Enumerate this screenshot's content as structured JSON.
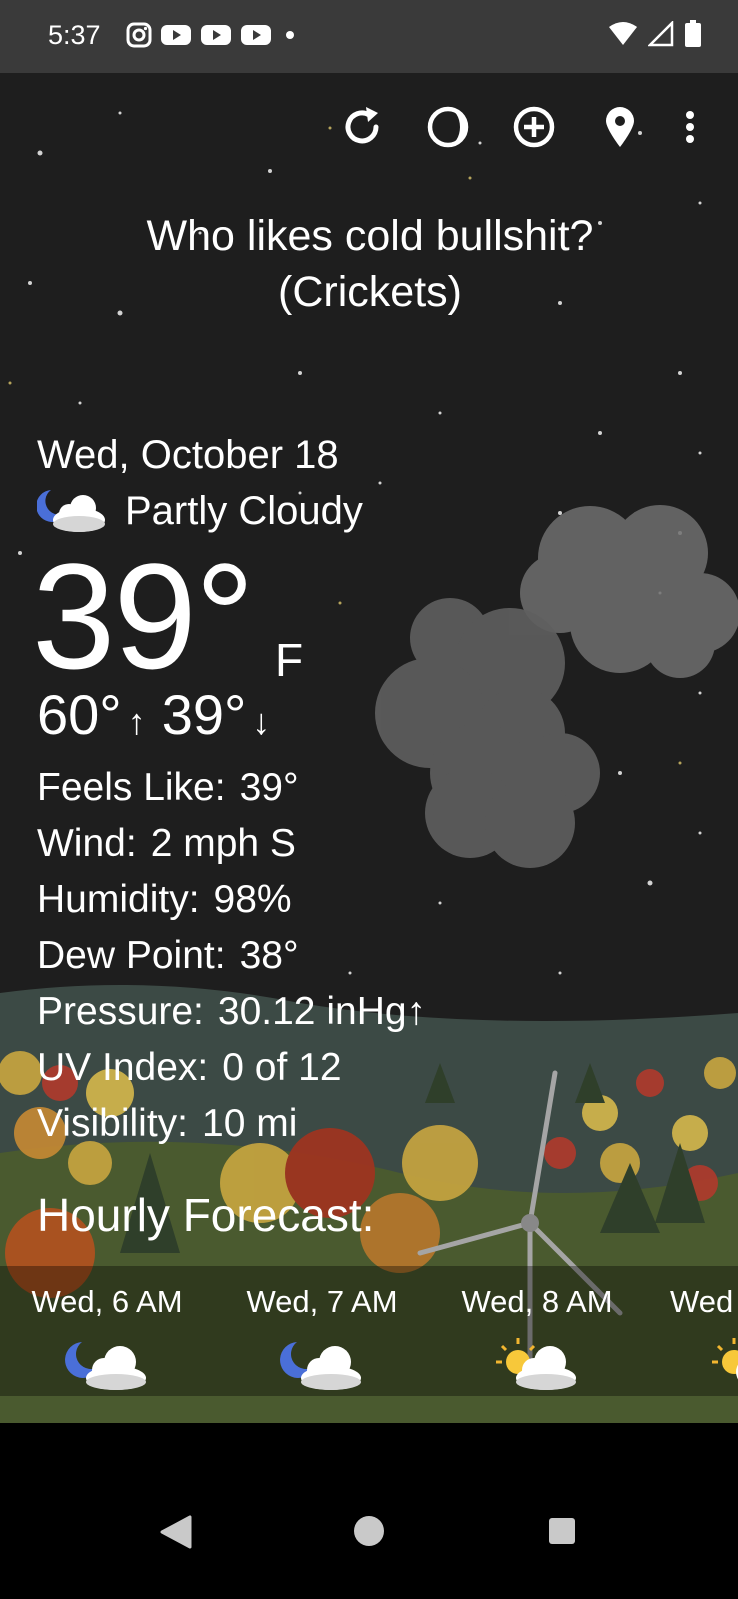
{
  "status_bar": {
    "time": "5:37",
    "notification_icons": [
      "instagram-icon",
      "youtube-icon",
      "youtube-icon",
      "youtube-icon",
      "dot-icon"
    ],
    "system_icons": [
      "wifi-icon",
      "cellular-signal-icon",
      "battery-icon"
    ]
  },
  "toolbar": {
    "icons": [
      "refresh-icon",
      "moon-phase-icon",
      "add-location-icon",
      "location-pin-icon",
      "more-options-icon"
    ]
  },
  "quote": {
    "line1": "Who likes cold bullshit?",
    "line2": "(Crickets)"
  },
  "current": {
    "date": "Wed, October 18",
    "condition": "Partly Cloudy",
    "condition_icon": "partly-cloudy-night-icon",
    "temperature": "39°",
    "unit": "F",
    "high": "60°",
    "low": "39°",
    "high_arrow": "↑",
    "low_arrow": "↓"
  },
  "details": [
    {
      "label": "Feels Like:",
      "value": "39°"
    },
    {
      "label": "Wind:",
      "value": "2 mph S"
    },
    {
      "label": "Humidity:",
      "value": "98%"
    },
    {
      "label": "Dew Point:",
      "value": "38°"
    },
    {
      "label": "Pressure:",
      "value": "30.12 inHg↑"
    },
    {
      "label": "UV Index:",
      "value": "0 of 12"
    },
    {
      "label": "Visibility:",
      "value": "10 mi"
    }
  ],
  "hourly": {
    "title": "Hourly Forecast:",
    "items": [
      {
        "label": "Wed, 6 AM",
        "icon": "partly-cloudy-night-icon"
      },
      {
        "label": "Wed, 7 AM",
        "icon": "partly-cloudy-night-icon"
      },
      {
        "label": "Wed, 8 AM",
        "icon": "partly-sunny-icon"
      },
      {
        "label": "Wed",
        "icon": "partly-sunny-icon"
      }
    ]
  },
  "nav_bar": {
    "icons": [
      "back-icon",
      "home-icon",
      "recents-icon"
    ]
  },
  "colors": {
    "status_bar_bg": "#3a3a3a",
    "scene_bg": "#1e1e1e",
    "text": "#ffffff"
  }
}
